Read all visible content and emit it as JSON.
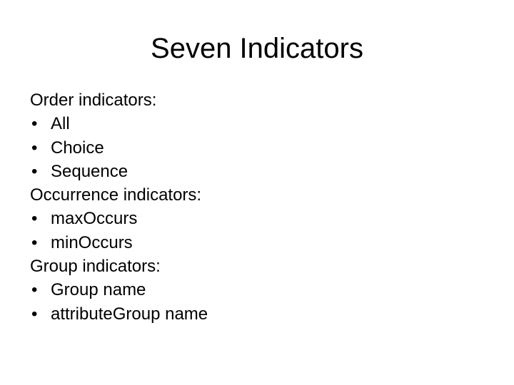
{
  "slide": {
    "title": "Seven Indicators",
    "bullet_glyph": "•",
    "sections": [
      {
        "heading": "Order indicators:",
        "items": [
          "All",
          "Choice",
          "Sequence"
        ]
      },
      {
        "heading": "Occurrence indicators:",
        "items": [
          "maxOccurs",
          "minOccurs"
        ]
      },
      {
        "heading": "Group indicators:",
        "items": [
          "Group name",
          "attributeGroup name"
        ]
      }
    ]
  }
}
